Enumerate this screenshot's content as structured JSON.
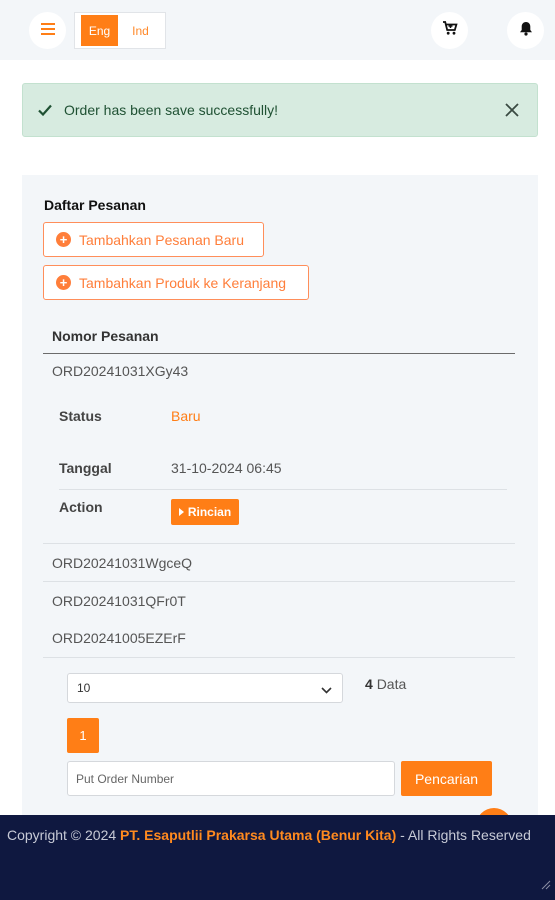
{
  "header": {
    "lang_active": "Eng",
    "lang_inactive": "Ind",
    "accent_color": "#ff7e16"
  },
  "alert": {
    "message": "Order has been save successfully!"
  },
  "orders": {
    "title": "Daftar Pesanan",
    "add_order_label": "Tambahkan Pesanan Baru",
    "add_product_label": "Tambahkan Produk ke Keranjang",
    "column_header": "Nomor Pesanan",
    "rows": [
      "ORD20241031XGy43",
      "ORD20241031WgceQ",
      "ORD20241031QFr0T",
      "ORD20241005EZErF"
    ],
    "detail": {
      "status_label": "Status",
      "status_value": "Baru",
      "date_label": "Tanggal",
      "date_value": "31-10-2024 06:45",
      "action_label": "Action",
      "action_button": "Rincian"
    }
  },
  "pagination": {
    "page_size": "10",
    "count_number": "4",
    "count_label": "Data",
    "current_page": "1"
  },
  "search": {
    "placeholder": "Put Order Number",
    "button_label": "Pencarian"
  },
  "footer": {
    "copyright": "Copyright © 2024",
    "brand": "PT. Esaputlii Prakarsa Utama (Benur Kita)",
    "suffix": "- All Rights Reserved"
  }
}
